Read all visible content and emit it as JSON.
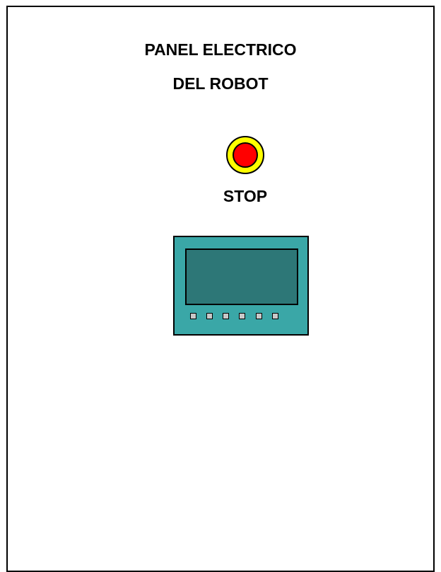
{
  "panel": {
    "title_line_1": "PANEL ELECTRICO",
    "title_line_2": "DEL ROBOT"
  },
  "stop_button": {
    "label": "STOP",
    "ring_color": "#ffff00",
    "button_color": "#ff0000"
  },
  "hmi_terminal": {
    "body_color": "#3aa7a7",
    "screen_color": "#2d7777",
    "key_count": 6,
    "key_color": "#c8c8c8"
  }
}
